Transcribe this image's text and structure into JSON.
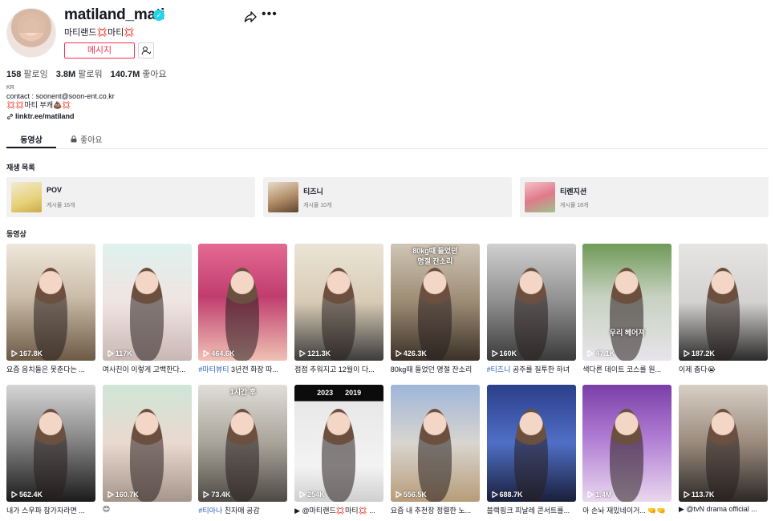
{
  "profile": {
    "username": "matiland_mati",
    "nickname": "마티랜드💢마티💢",
    "message_label": "메시지"
  },
  "stats": [
    {
      "num": "158",
      "label": "팔로잉"
    },
    {
      "num": "3.8M",
      "label": "팔로워"
    },
    {
      "num": "140.7M",
      "label": "좋아요"
    }
  ],
  "bio": {
    "region": "KR",
    "contact": "contact : soonent@soon-ent.co.kr",
    "line3": "💢💢마티 부캐💩💢",
    "link": "linktr.ee/matiland"
  },
  "tabs": {
    "videos": "동영상",
    "liked": "좋아요"
  },
  "playlist_section_title": "재생 목록",
  "playlists": [
    {
      "name": "POV",
      "count": "게시물 16개"
    },
    {
      "name": "티즈니",
      "count": "게시물 10개"
    },
    {
      "name": "티렌지션",
      "count": "게시물 18개"
    }
  ],
  "videos_section_title": "동영상",
  "videos": [
    {
      "views": "167.8K",
      "caption": "요즘 음치들은 못춘다는 ...",
      "overlay": ""
    },
    {
      "views": "117K",
      "caption": "여사친이 이렇게 고백한다...",
      "overlay": ""
    },
    {
      "views": "464.6K",
      "caption_tag": "#마티뷰티",
      "caption": " 3년전 화장 따...",
      "overlay": ""
    },
    {
      "views": "121.3K",
      "caption": "점점 추워지고 12월이 다...",
      "overlay": ""
    },
    {
      "views": "426.3K",
      "caption": "80kg때 들었던 명절 잔소리",
      "overlay": "80kg때 들었던\n명절 잔소리"
    },
    {
      "views": "160K",
      "caption_tag": "#티즈니",
      "caption": " 공주를 질투한 하녀",
      "overlay": ""
    },
    {
      "views": "47.1K",
      "caption": "색다른 데이트 코스를 원...",
      "overlay": "우리 헤어져"
    },
    {
      "views": "187.2K",
      "caption": "이제 춥다😭",
      "overlay": ""
    },
    {
      "views": "562.4K",
      "caption": "내가 스우파 참가자라면 ...",
      "overlay": ""
    },
    {
      "views": "160.7K",
      "caption": "😊",
      "overlay": ""
    },
    {
      "views": "73.4K",
      "caption_tag": "#티아나",
      "caption": " 친자매 공감",
      "overlay": "1시간 후"
    },
    {
      "views": "254K",
      "caption": "▶ @마티랜드💢마티💢 ...",
      "overlay": "2023      2019"
    },
    {
      "views": "556.5K",
      "caption": "요즘 내 추천장 정렬한 노...",
      "overlay": ""
    },
    {
      "views": "688.7K",
      "caption": "블랙핑크 피날레 콘서트를...",
      "overlay": ""
    },
    {
      "views": "1.4M",
      "caption": "아 손놔 재밌네이거... 🤜🤜",
      "overlay": ""
    },
    {
      "views": "113.7K",
      "caption": "▶ @tvN drama official ...",
      "overlay": ""
    }
  ],
  "colors": {
    "accent": "#fe2c55",
    "verified": "#20d5ec",
    "hashtag": "#2b5db9"
  }
}
